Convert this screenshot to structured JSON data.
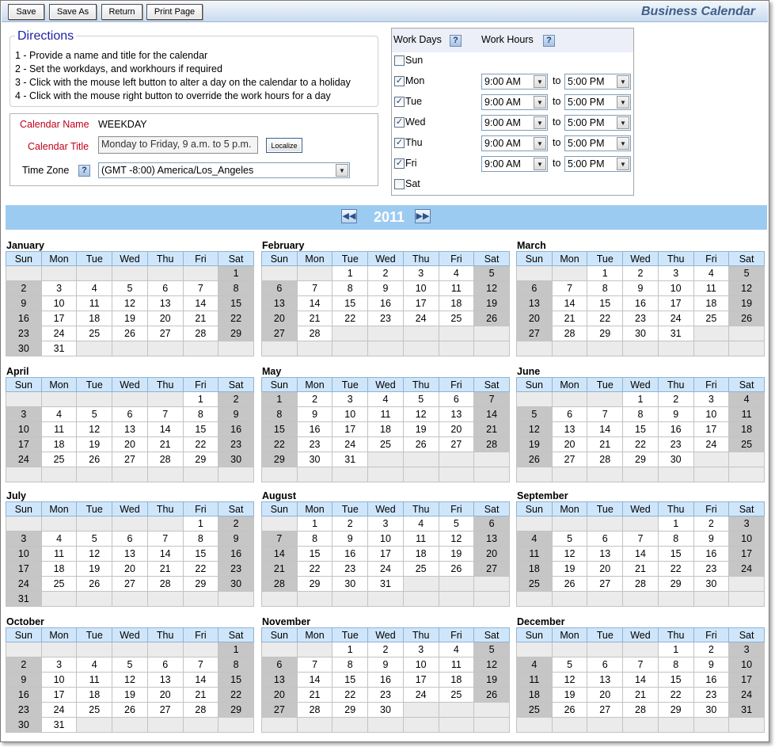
{
  "toolbar": {
    "buttons": [
      "Save",
      "Save As",
      "Return",
      "Print Page"
    ],
    "title": "Business Calendar"
  },
  "directions": {
    "title": "Directions",
    "lines": [
      "1 - Provide a name and title for the calendar",
      "2 - Set the workdays, and workhours if required",
      "3 - Click with the mouse left button to alter a day on the calendar to a holiday",
      "4 - Click with the mouse right button to override the work hours for a day"
    ]
  },
  "calendar_info": {
    "name_label": "Calendar Name",
    "name_value": "WEEKDAY",
    "title_label": "Calendar Title",
    "title_value": "Monday to Friday, 9 a.m. to 5 p.m.",
    "localize_label": "Localize",
    "timezone_label": "Time Zone",
    "timezone_value": "(GMT -8:00) America/Los_Angeles",
    "help_glyph": "?"
  },
  "workdays": {
    "days_header": "Work Days",
    "hours_header": "Work Hours",
    "to_label": "to",
    "days": [
      {
        "name": "Sun",
        "checked": false,
        "start": "",
        "end": ""
      },
      {
        "name": "Mon",
        "checked": true,
        "start": "9:00 AM",
        "end": "5:00 PM"
      },
      {
        "name": "Tue",
        "checked": true,
        "start": "9:00 AM",
        "end": "5:00 PM"
      },
      {
        "name": "Wed",
        "checked": true,
        "start": "9:00 AM",
        "end": "5:00 PM"
      },
      {
        "name": "Thu",
        "checked": true,
        "start": "9:00 AM",
        "end": "5:00 PM"
      },
      {
        "name": "Fri",
        "checked": true,
        "start": "9:00 AM",
        "end": "5:00 PM"
      },
      {
        "name": "Sat",
        "checked": false,
        "start": "",
        "end": ""
      }
    ]
  },
  "year": "2011",
  "weekday_headers": [
    "Sun",
    "Mon",
    "Tue",
    "Wed",
    "Thu",
    "Fri",
    "Sat"
  ],
  "months": [
    {
      "name": "January",
      "first_weekday": 6,
      "days": 31
    },
    {
      "name": "February",
      "first_weekday": 2,
      "days": 28
    },
    {
      "name": "March",
      "first_weekday": 2,
      "days": 31
    },
    {
      "name": "April",
      "first_weekday": 5,
      "days": 30
    },
    {
      "name": "May",
      "first_weekday": 0,
      "days": 31
    },
    {
      "name": "June",
      "first_weekday": 3,
      "days": 30
    },
    {
      "name": "July",
      "first_weekday": 5,
      "days": 31
    },
    {
      "name": "August",
      "first_weekday": 1,
      "days": 31
    },
    {
      "name": "September",
      "first_weekday": 4,
      "days": 30
    },
    {
      "name": "October",
      "first_weekday": 6,
      "days": 31
    },
    {
      "name": "November",
      "first_weekday": 2,
      "days": 30
    },
    {
      "name": "December",
      "first_weekday": 4,
      "days": 31
    }
  ]
}
